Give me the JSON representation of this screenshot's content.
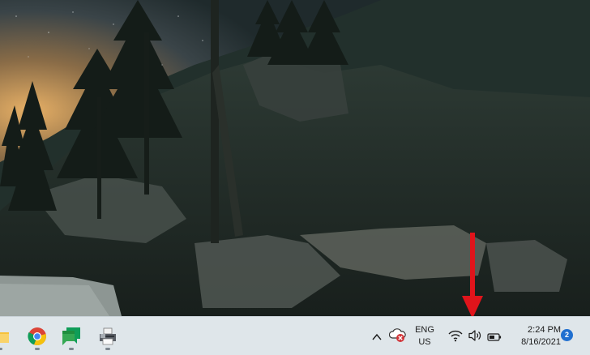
{
  "desktop": {
    "wallpaper": "night-forest-hillside-wallpaper",
    "annotation_color": "#e0141b"
  },
  "taskbar": {
    "apps": [
      {
        "name": "File Explorer",
        "icon": "folder-icon"
      },
      {
        "name": "Google Chrome",
        "icon": "chrome-icon"
      },
      {
        "name": "Google Chat",
        "icon": "chat-icon"
      },
      {
        "name": "Printer",
        "icon": "printer-icon"
      }
    ],
    "tray": {
      "overflow_icon": "chevron-up-icon",
      "onedrive_icon": "onedrive-error-icon",
      "language_line1": "ENG",
      "language_line2": "US",
      "wifi_icon": "wifi-icon",
      "volume_icon": "speaker-icon",
      "battery_icon": "battery-icon",
      "time": "2:24 PM",
      "date": "8/16/2021",
      "notification_count": "2"
    },
    "accent": "#1f6fd0",
    "background": "#dfe6ea"
  }
}
